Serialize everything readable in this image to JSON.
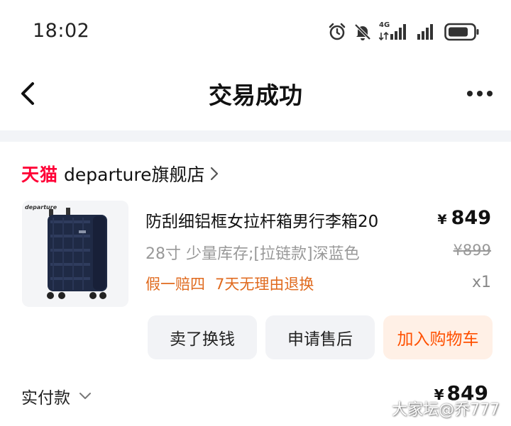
{
  "status_bar": {
    "time": "18:02",
    "network_label": "4G"
  },
  "nav": {
    "title": "交易成功"
  },
  "store": {
    "brand": "天猫",
    "name": "departure旗舰店"
  },
  "product": {
    "thumb_brand": "departure",
    "title": "防刮细铝框女拉杆箱男行李箱20",
    "price_symbol": "¥",
    "price": "849",
    "spec": "28寸 少量库存;[拉链款]深蓝色",
    "original_price": "¥899",
    "promo_1": "假一赔四",
    "promo_2": "7天无理由退换",
    "quantity": "x1"
  },
  "actions": {
    "sell": "卖了换钱",
    "after_sales": "申请售后",
    "add_cart": "加入购物车"
  },
  "payment": {
    "label": "实付款",
    "symbol": "¥",
    "amount": "849"
  },
  "watermark": "大家坛@乔777",
  "colors": {
    "tmall_red": "#ff0036",
    "promo_orange": "#e06a1e",
    "cart_orange": "#ff5000",
    "cart_bg": "#fff0e6"
  }
}
